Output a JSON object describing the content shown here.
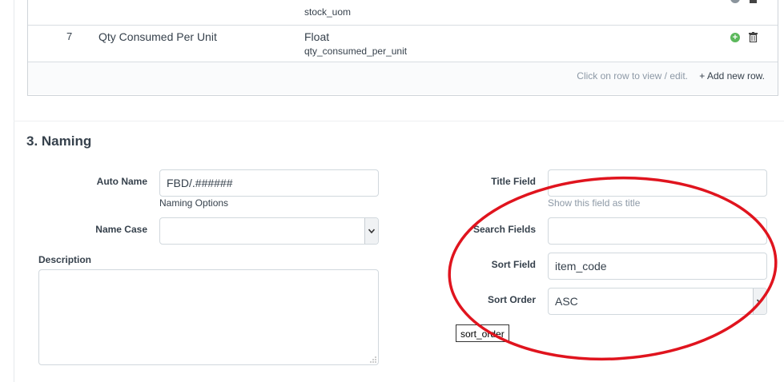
{
  "grid": {
    "rows": [
      {
        "idx": "",
        "label": "",
        "type": "",
        "fieldname": "stock_uom"
      },
      {
        "idx": "7",
        "label": "Qty Consumed Per Unit",
        "type": "Float",
        "fieldname": "qty_consumed_per_unit"
      }
    ],
    "hint": "Click on row to view / edit.",
    "add_row": "+ Add new row.",
    "icons": [
      "add-row-icon",
      "delete-icon"
    ]
  },
  "section": {
    "title": "3. Naming"
  },
  "form": {
    "auto_name": {
      "label": "Auto Name",
      "value": "FBD/.######",
      "help": "Naming Options"
    },
    "name_case": {
      "label": "Name Case",
      "value": ""
    },
    "description": {
      "label": "Description",
      "value": ""
    },
    "title_field": {
      "label": "Title Field",
      "value": "",
      "help": "Show this field as title"
    },
    "search_fields": {
      "label": "Search Fields",
      "value": ""
    },
    "sort_field": {
      "label": "Sort Field",
      "value": "item_code"
    },
    "sort_order": {
      "label": "Sort Order",
      "value": "ASC"
    }
  },
  "tooltip": "sort_order",
  "colors": {
    "accent_plus": "#5cb85c",
    "annotation_red": "#e0141e",
    "help_text": "#8d99a6"
  }
}
